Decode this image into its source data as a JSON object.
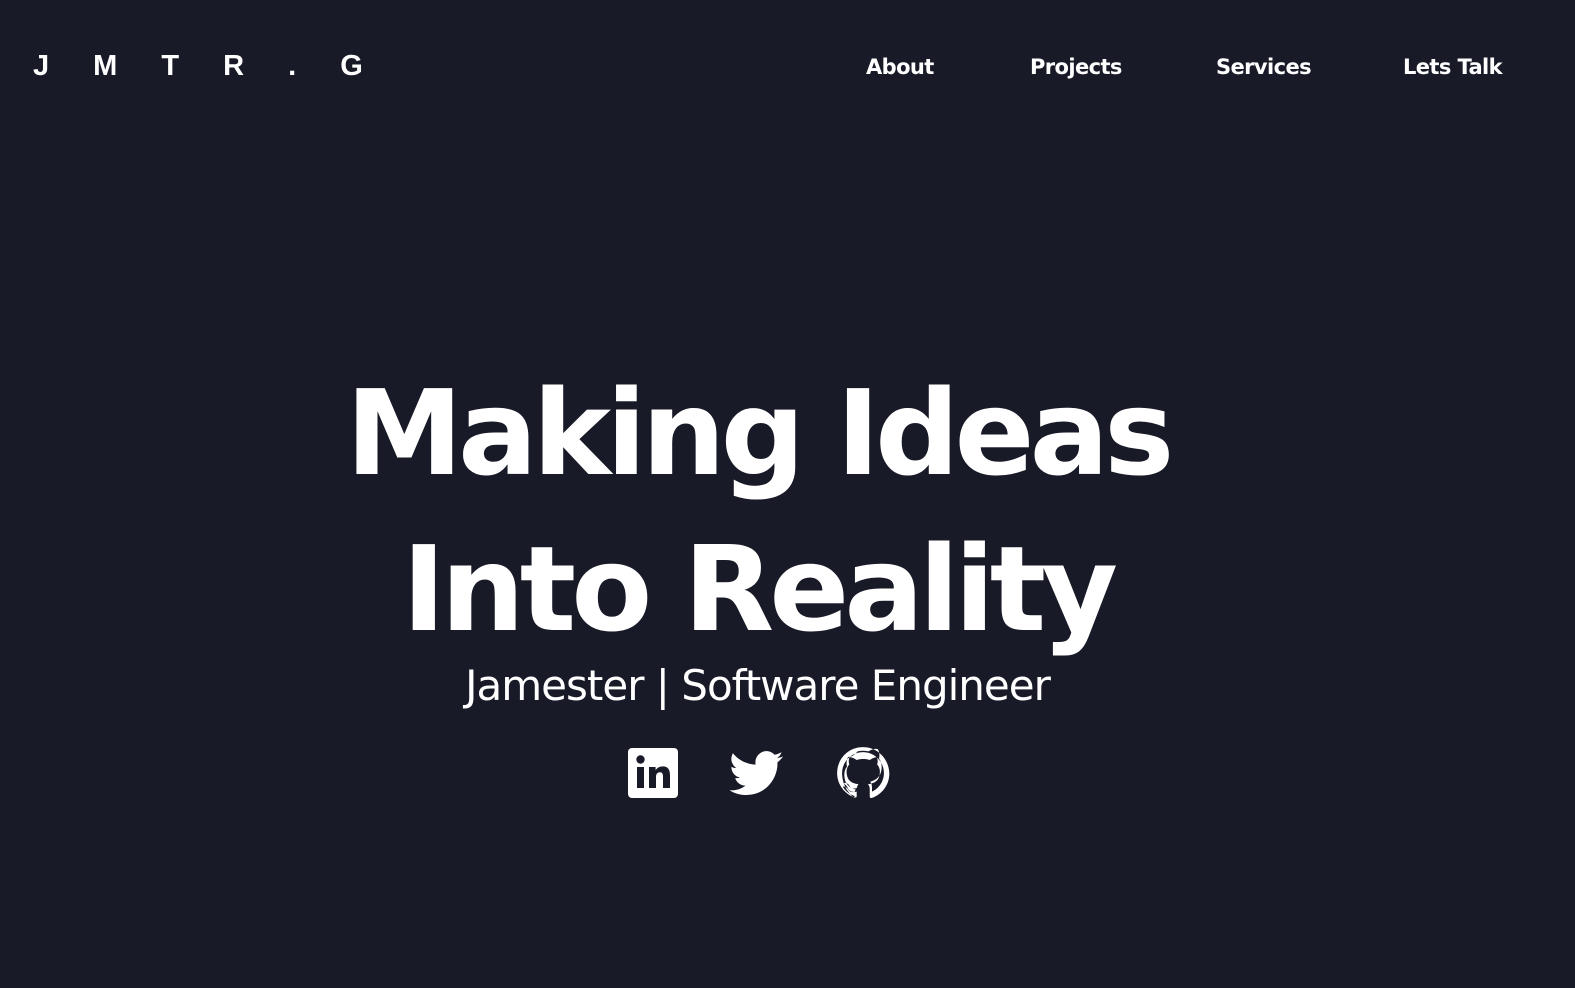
{
  "header": {
    "logo": "J M T R . G",
    "nav": {
      "about": "About",
      "projects": "Projects",
      "services": "Services",
      "lets_talk": "Lets Talk"
    }
  },
  "hero": {
    "title_line_1": "Making Ideas",
    "title_line_2": "Into Reality",
    "subtitle": "Jamester | Software Engineer"
  },
  "socials": [
    {
      "icon": "linkedin-icon"
    },
    {
      "icon": "twitter-icon"
    },
    {
      "icon": "github-icon"
    }
  ],
  "colors": {
    "background": "#181a27",
    "text": "#ffffff"
  }
}
